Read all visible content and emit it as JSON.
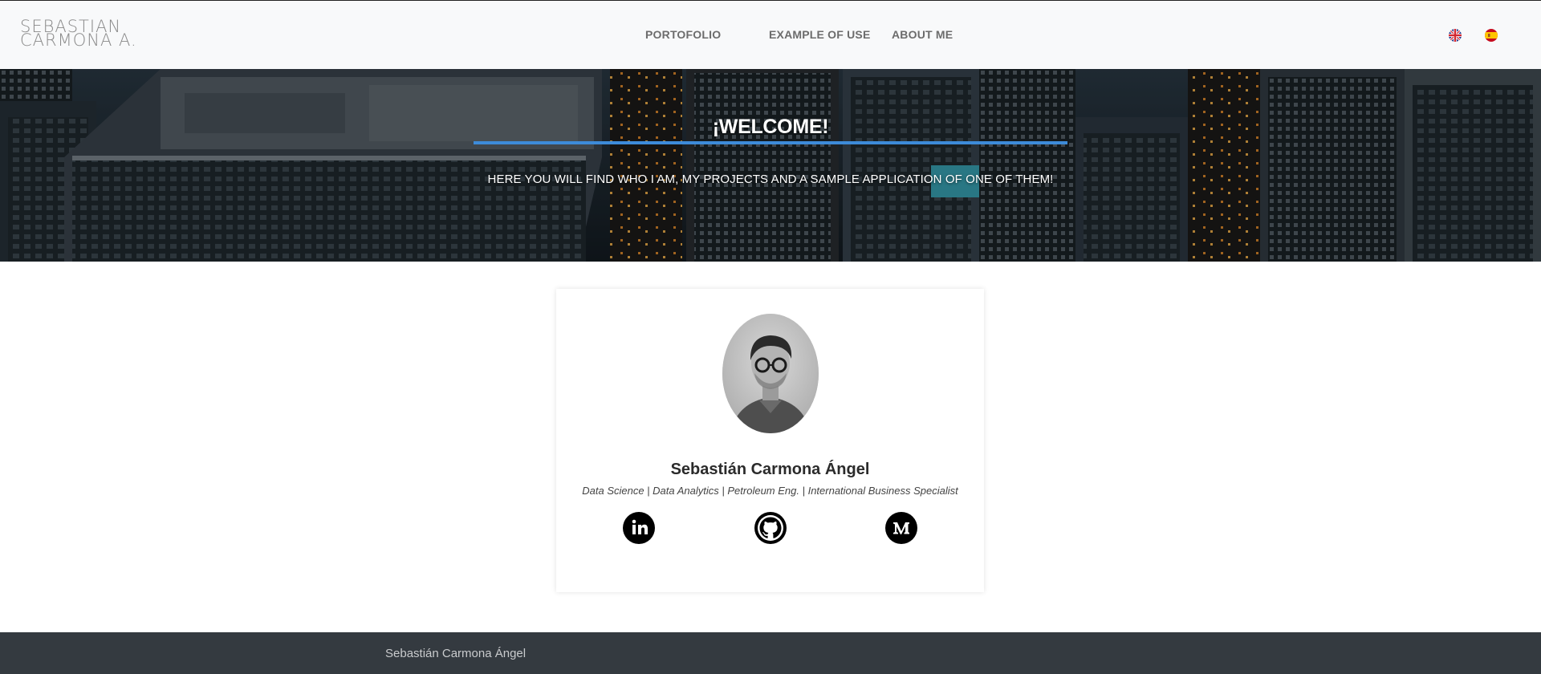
{
  "navbar": {
    "logo_line1": "SEBASTIAN",
    "logo_line2": "CARMONA A.",
    "links": [
      {
        "label": "PORTOFOLIO"
      },
      {
        "label": "EXAMPLE OF USE"
      },
      {
        "label": "ABOUT ME"
      }
    ],
    "languages": [
      {
        "name": "english-flag-icon"
      },
      {
        "name": "spanish-flag-icon"
      }
    ]
  },
  "hero": {
    "title": "¡WELCOME!",
    "subtitle": "HERE YOU WILL FIND WHO I AM, MY PROJECTS AND A SAMPLE APPLICATION OF ONE OF THEM!"
  },
  "profile": {
    "name": "Sebastián Carmona Ángel",
    "tagline": "Data Science | Data Analytics | Petroleum Eng. | International Business Specialist",
    "socials": [
      {
        "icon": "linkedin-icon"
      },
      {
        "icon": "github-icon"
      },
      {
        "icon": "medium-icon"
      }
    ]
  },
  "footer": {
    "text": "Sebastián Carmona Ángel"
  },
  "colors": {
    "accent": "#3d8bd9",
    "navbar_bg": "#f8f9fa",
    "footer_bg": "#343a40"
  }
}
